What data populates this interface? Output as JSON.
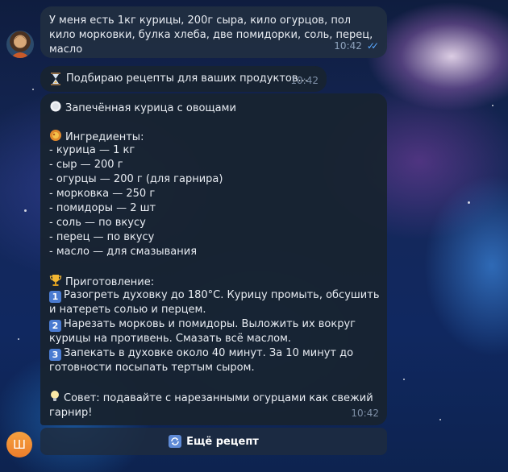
{
  "messages": {
    "user": {
      "text": "У меня есть 1кг курицы, 200г сыра, кило огурцов, пол кило морковки, булка хлеба, две помидорки, соль, перец, масло",
      "time": "10:42",
      "status_icon": "double-check-icon"
    },
    "loading": {
      "icon": "hourglass-icon",
      "text": "Подбираю рецепты для ваших продуктов...",
      "time": "10:42"
    },
    "recipe": {
      "title": "Запечённая курица с овощами",
      "title_icon": "plate-icon",
      "ingredients_label": "Ингредиенты:",
      "ingredients_icon": "food-icon",
      "ingredients": [
        "- курица — 1 кг",
        "- сыр — 200 г",
        "- огурцы — 200 г (для гарнира)",
        "- морковка — 250 г",
        "- помидоры — 2 шт",
        "- соль — по вкусу",
        "- перец — по вкусу",
        "- масло — для смазывания"
      ],
      "cooking_label": "Приготовление:",
      "cooking_icon": "trophy-icon",
      "steps": [
        {
          "num": "1",
          "text": "Разогреть духовку до 180°C. Курицу промыть, обсушить и натереть солью и перцем."
        },
        {
          "num": "2",
          "text": "Нарезать морковь и помидоры. Выложить их вокруг курицы на противень. Смазать всё маслом."
        },
        {
          "num": "3",
          "text": "Запекать в духовке около 40 минут. За 10 минут до готовности посыпать тертым сыром."
        }
      ],
      "tip_icon": "lightbulb-icon",
      "tip": "Совет: подавайте с нарезанными огурцами как свежий гарнир!",
      "time": "10:42"
    }
  },
  "keyboard": {
    "more_button": "Ещё рецепт",
    "more_icon": "refresh-icon"
  },
  "bot_avatar_letter": "Ш",
  "colors": {
    "bubble": "#182331",
    "user_bubble": "#202e42",
    "accent": "#59a8ff",
    "bot_avatar": "#f08a30"
  }
}
